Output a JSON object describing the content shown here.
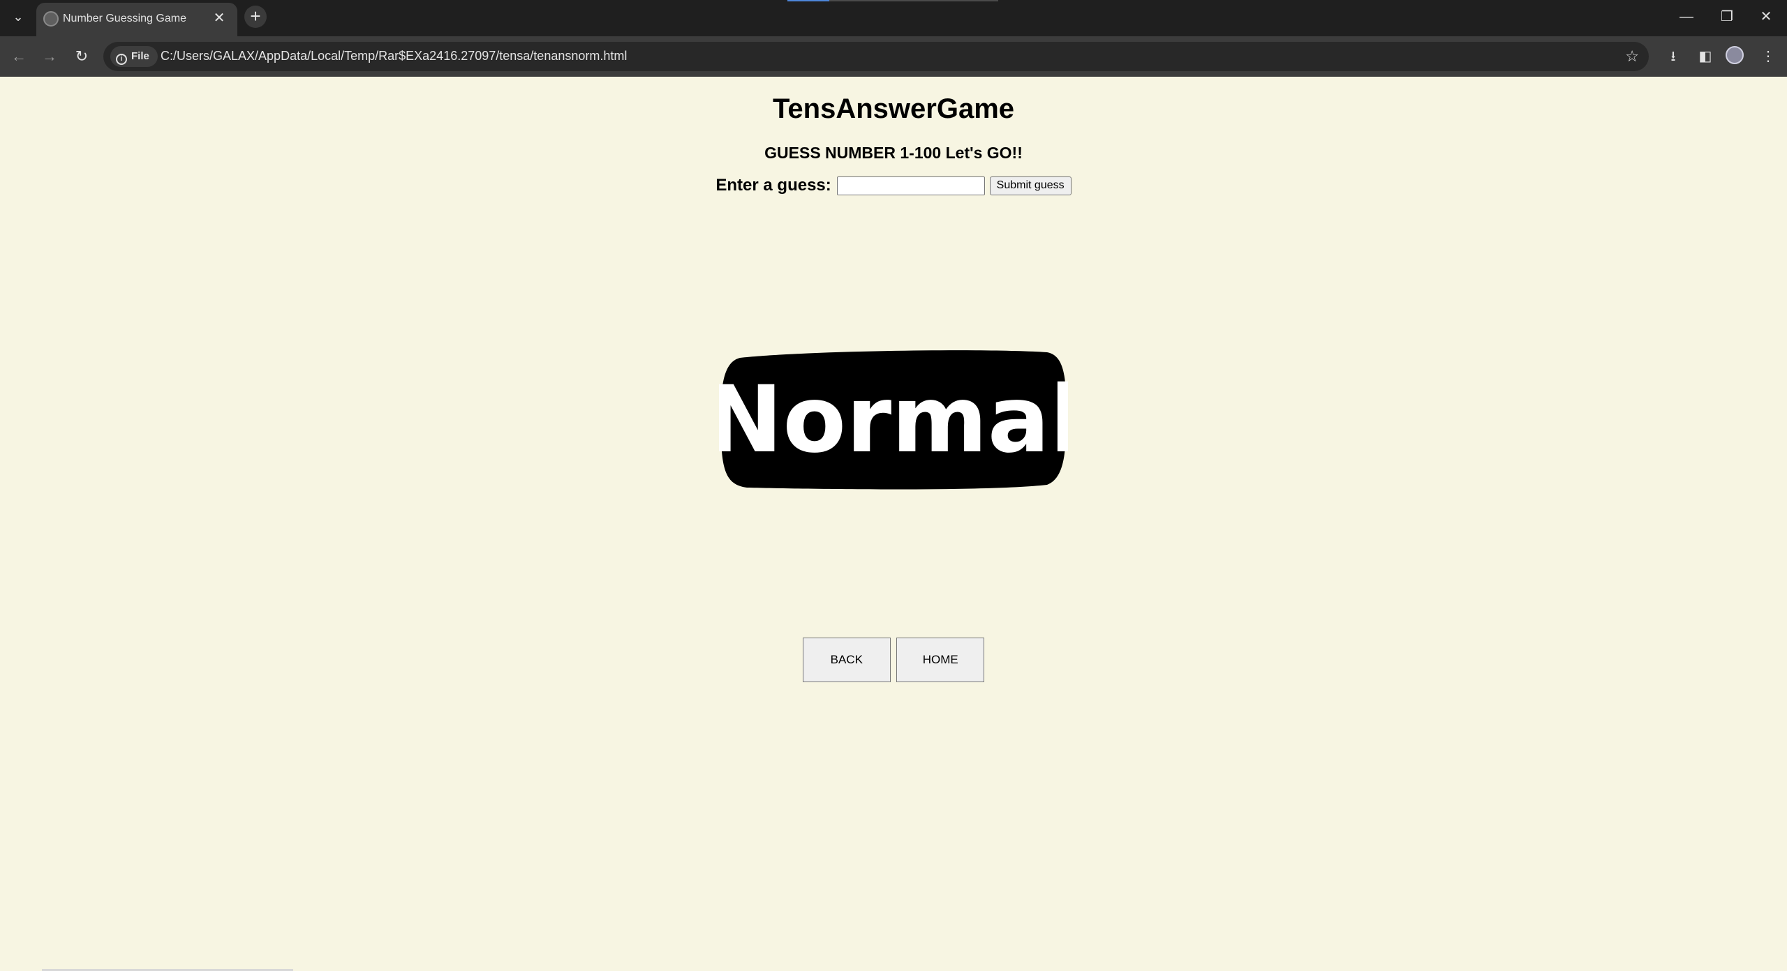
{
  "browser": {
    "tab_title": "Number Guessing Game",
    "url": "C:/Users/GALAX/AppData/Local/Temp/Rar$EXa2416.27097/tensa/tenansnorm.html",
    "security_chip": "File",
    "icons": {
      "tab_search": "chevron-down-icon",
      "back": "arrow-left-icon",
      "forward": "arrow-right-icon",
      "reload": "reload-icon",
      "bookmark": "star-icon",
      "download": "download-icon",
      "side_panel": "side-panel-icon",
      "menu": "kebab-menu-icon"
    }
  },
  "page": {
    "title": "TensAnswerGame",
    "subtitle": "GUESS NUMBER 1-100 Let's GO!!",
    "guess_label": "Enter a guess:",
    "guess_value": "",
    "submit_label": "Submit guess",
    "badge_text": "Normal",
    "back_label": "BACK",
    "home_label": "HOME"
  },
  "colors": {
    "page_background": "#f7f5e2",
    "badge_fill": "#000000",
    "badge_text": "#ffffff"
  }
}
